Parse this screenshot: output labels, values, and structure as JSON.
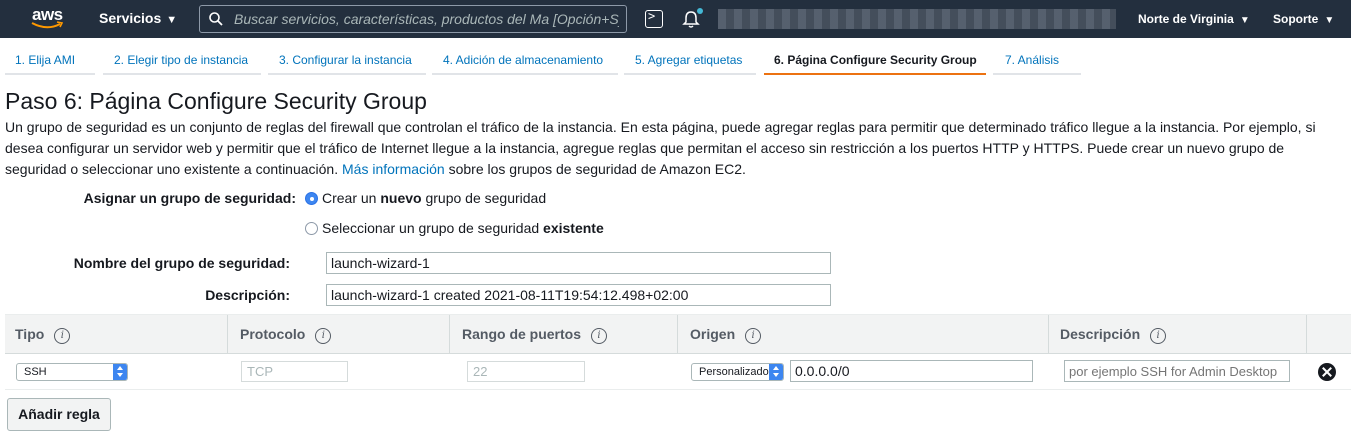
{
  "nav": {
    "logo_text": "aws",
    "services_label": "Servicios",
    "search_placeholder": "Buscar servicios, características, productos del Ma [Opción+S]",
    "region_label": "Norte de Virginia",
    "support_label": "Soporte"
  },
  "wizard": {
    "steps": [
      {
        "label": "1. Elija AMI"
      },
      {
        "label": "2. Elegir tipo de instancia"
      },
      {
        "label": "3. Configurar la instancia"
      },
      {
        "label": "4. Adición de almacenamiento"
      },
      {
        "label": "5. Agregar etiquetas"
      },
      {
        "label": "6. Página Configure Security Group"
      },
      {
        "label": "7. Análisis"
      }
    ],
    "active_step": 6
  },
  "page": {
    "title": "Paso 6: Página Configure Security Group",
    "description_1": "Un grupo de seguridad es un conjunto de reglas del firewall que controlan el tráfico de la instancia. En esta página, puede agregar reglas para permitir que determinado tráfico llegue a la instancia. Por ejemplo, si desea configurar un servidor web y permitir que el tráfico de Internet llegue a la instancia, agregue reglas que permitan el acceso sin restricción a los puertos HTTP y HTTPS. Puede crear un nuevo grupo de seguridad o seleccionar uno existente a continuación.",
    "more_info_link": "Más información",
    "description_2": "sobre los grupos de seguridad de Amazon EC2."
  },
  "form": {
    "assign_label": "Asignar un grupo de seguridad:",
    "option_new_prefix": "Crear un",
    "option_new_bold": "nuevo",
    "option_new_suffix": "grupo de seguridad",
    "option_existing_prefix": "Seleccionar un grupo de seguridad",
    "option_existing_bold": "existente",
    "selected_option": "new",
    "name_label": "Nombre del grupo de seguridad:",
    "name_value": "launch-wizard-1",
    "description_label": "Descripción:",
    "description_value": "launch-wizard-1 created 2021-08-11T19:54:12.498+02:00"
  },
  "rules_table": {
    "columns": [
      "Tipo",
      "Protocolo",
      "Rango de puertos",
      "Origen",
      "Descripción"
    ],
    "info_glyph": "i",
    "rows": [
      {
        "type": "SSH",
        "protocol": "TCP",
        "port_range": "22",
        "source_type": "Personalizado",
        "source_value": "0.0.0.0/0",
        "description_placeholder": "por ejemplo SSH for Admin Desktop"
      }
    ],
    "add_rule_label": "Añadir regla"
  },
  "colors": {
    "nav_bg": "#232f3e",
    "link": "#0073bb",
    "active_tab": "#ec7211",
    "radio_selected": "#3d86f0"
  }
}
